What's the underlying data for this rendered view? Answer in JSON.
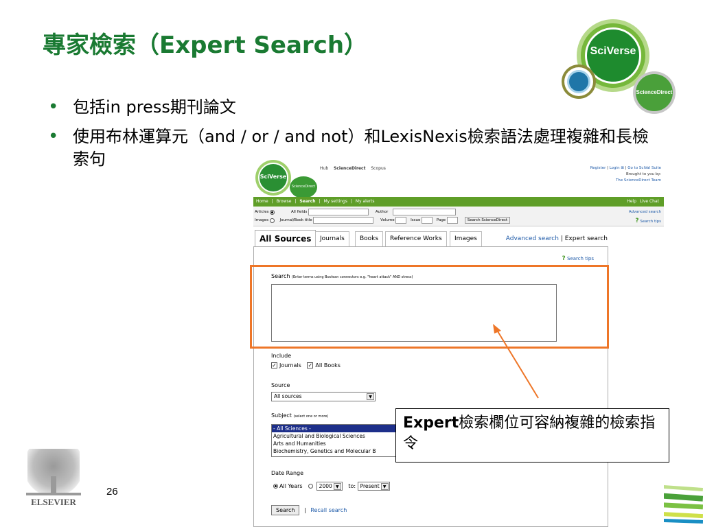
{
  "slide": {
    "title": "專家檢索（Expert Search）",
    "bullets": [
      "包括in press期刊論文",
      "使用布林運算元（and / or / and not）和LexisNexis檢索語法處理複雜和長檢索句"
    ],
    "page_number": "26",
    "elsevier_wordmark": "ELSEVIER",
    "logo": {
      "sciverse": "SciVerse",
      "sciencedirect": "ScienceDirect"
    },
    "callout": {
      "bold": "Expert",
      "text": "檢索欄位可容納複雜的檢索指令"
    },
    "colors": {
      "title": "#1a7a32",
      "highlight": "#ee7628",
      "bullet": "#1a7a32"
    }
  },
  "screenshot": {
    "logo": {
      "sciverse": "SciVerse",
      "sciencedirect": "ScienceDirect"
    },
    "top_nav": [
      "Hub",
      "ScienceDirect",
      "Scopus"
    ],
    "top_right": {
      "register": "Register",
      "login": "Login",
      "login_icon": "⊞",
      "sep1": "|",
      "sep2": "|",
      "scival": "Go to SciVal Suite",
      "brought": "Brought to you by:",
      "team": "The ScienceDirect Team"
    },
    "green_bar": {
      "items": [
        "Home",
        "|",
        "Browse",
        "|",
        "Search",
        "|",
        "My settings",
        "|",
        "My alerts"
      ],
      "right": [
        "Help",
        "Live Chat"
      ]
    },
    "quick_search": {
      "articles": "Articles",
      "images": "Images",
      "all_fields": "All fields",
      "journal_book_title": "Journal/Book title",
      "author": "Author",
      "volume": "Volume",
      "issue": "Issue",
      "page": "Page",
      "button": "Search ScienceDirect",
      "advanced_link": "Advanced search",
      "tips_link": "Search tips"
    },
    "tabs": [
      "All Sources",
      "Journals",
      "Books",
      "Reference Works",
      "Images"
    ],
    "tab_links": {
      "advanced": "Advanced search",
      "sep": "|",
      "expert": "Expert search"
    },
    "form": {
      "search_tips": "Search tips",
      "search_label": "Search",
      "search_hint": "(Enter terms using Boolean connectors e.g. \"heart attack\" AND stress)",
      "search_value": "",
      "include_label": "Include",
      "include_journals": "Journals",
      "include_books": "All Books",
      "source_label": "Source",
      "source_value": "All sources",
      "subject_label": "Subject",
      "subject_hint": "(select one or more)",
      "subjects": [
        "- All Sciences -",
        "Agricultural and Biological Sciences",
        "Arts and Humanities",
        "Biochemistry, Genetics and Molecular B"
      ],
      "date_range_label": "Date Range",
      "all_years": "All Years",
      "from_year": "2000",
      "to_label": "to:",
      "to_value": "Present",
      "search_button": "Search",
      "sep": "|",
      "recall_search": "Recall search"
    }
  }
}
